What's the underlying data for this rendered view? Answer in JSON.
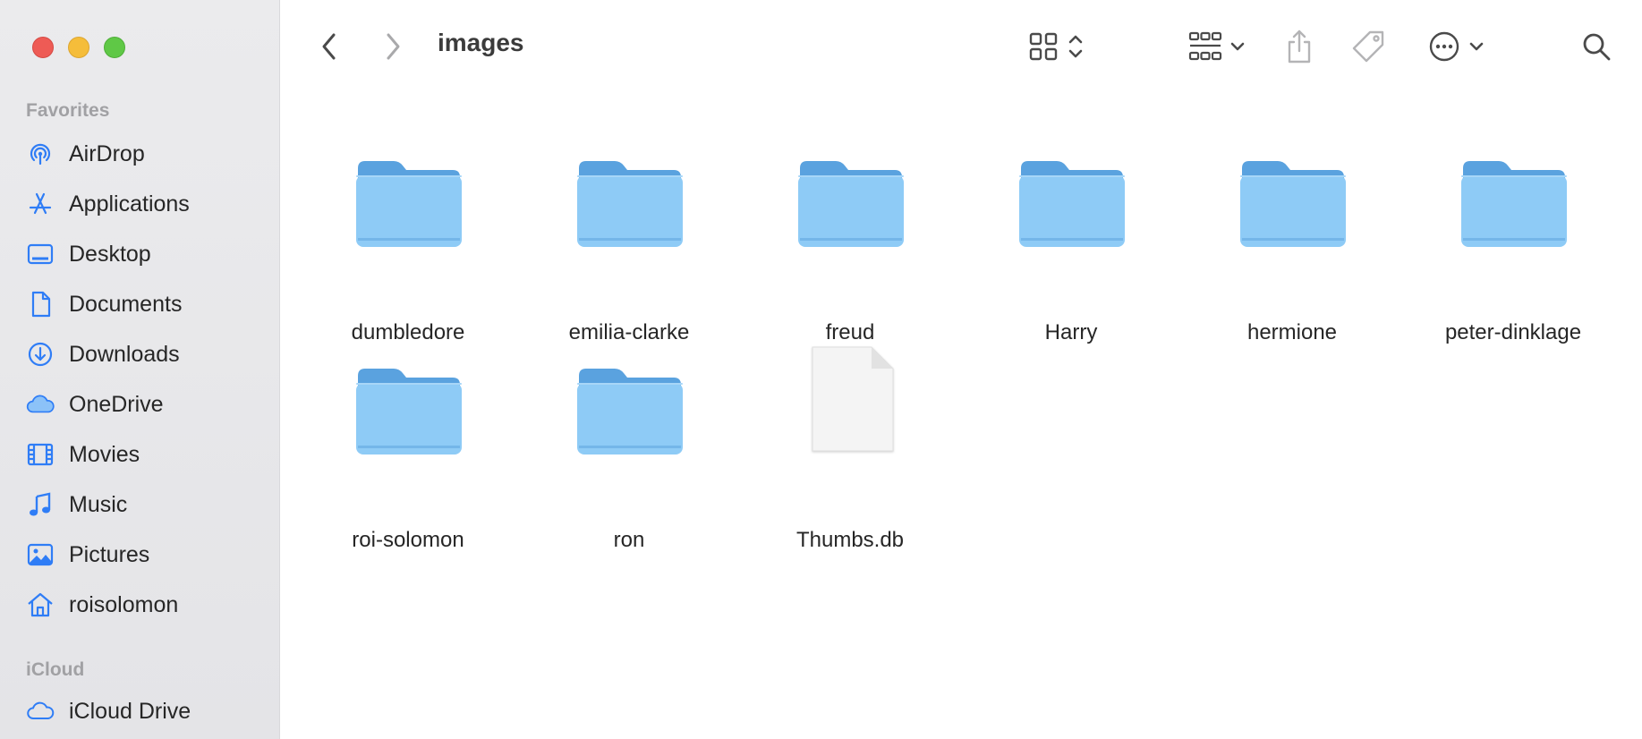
{
  "window": {
    "title": "images"
  },
  "colors": {
    "accent": "#2f7df6",
    "folder_front": "#8ecbf6",
    "folder_back": "#5aa2df",
    "sidebar_bg": "#e8e8ea"
  },
  "sidebar": {
    "favorites_label": "Favorites",
    "icloud_label": "iCloud",
    "favorites": [
      {
        "label": "AirDrop",
        "icon": "airdrop-icon"
      },
      {
        "label": "Applications",
        "icon": "applications-icon"
      },
      {
        "label": "Desktop",
        "icon": "desktop-icon"
      },
      {
        "label": "Documents",
        "icon": "document-icon"
      },
      {
        "label": "Downloads",
        "icon": "download-icon"
      },
      {
        "label": "OneDrive",
        "icon": "cloud-icon"
      },
      {
        "label": "Movies",
        "icon": "film-icon"
      },
      {
        "label": "Music",
        "icon": "music-note-icon"
      },
      {
        "label": "Pictures",
        "icon": "photo-icon"
      },
      {
        "label": "roisolomon",
        "icon": "home-icon"
      }
    ],
    "icloud": [
      {
        "label": "iCloud Drive",
        "icon": "icloud-icon"
      }
    ]
  },
  "toolbar": {
    "back_icon": "chevron-left-icon",
    "forward_icon": "chevron-right-icon",
    "view_icon": "grid-view-icon",
    "group_icon": "group-icon",
    "share_icon": "share-icon",
    "tag_icon": "tag-icon",
    "more_icon": "more-icon",
    "search_icon": "search-icon"
  },
  "files": [
    {
      "name": "dumbledore",
      "kind": "folder"
    },
    {
      "name": "emilia-clarke",
      "kind": "folder"
    },
    {
      "name": "freud",
      "kind": "folder"
    },
    {
      "name": "Harry",
      "kind": "folder"
    },
    {
      "name": "hermione",
      "kind": "folder"
    },
    {
      "name": "peter-dinklage",
      "kind": "folder"
    },
    {
      "name": "roi-solomon",
      "kind": "folder"
    },
    {
      "name": "ron",
      "kind": "folder"
    },
    {
      "name": "Thumbs.db",
      "kind": "document"
    }
  ]
}
